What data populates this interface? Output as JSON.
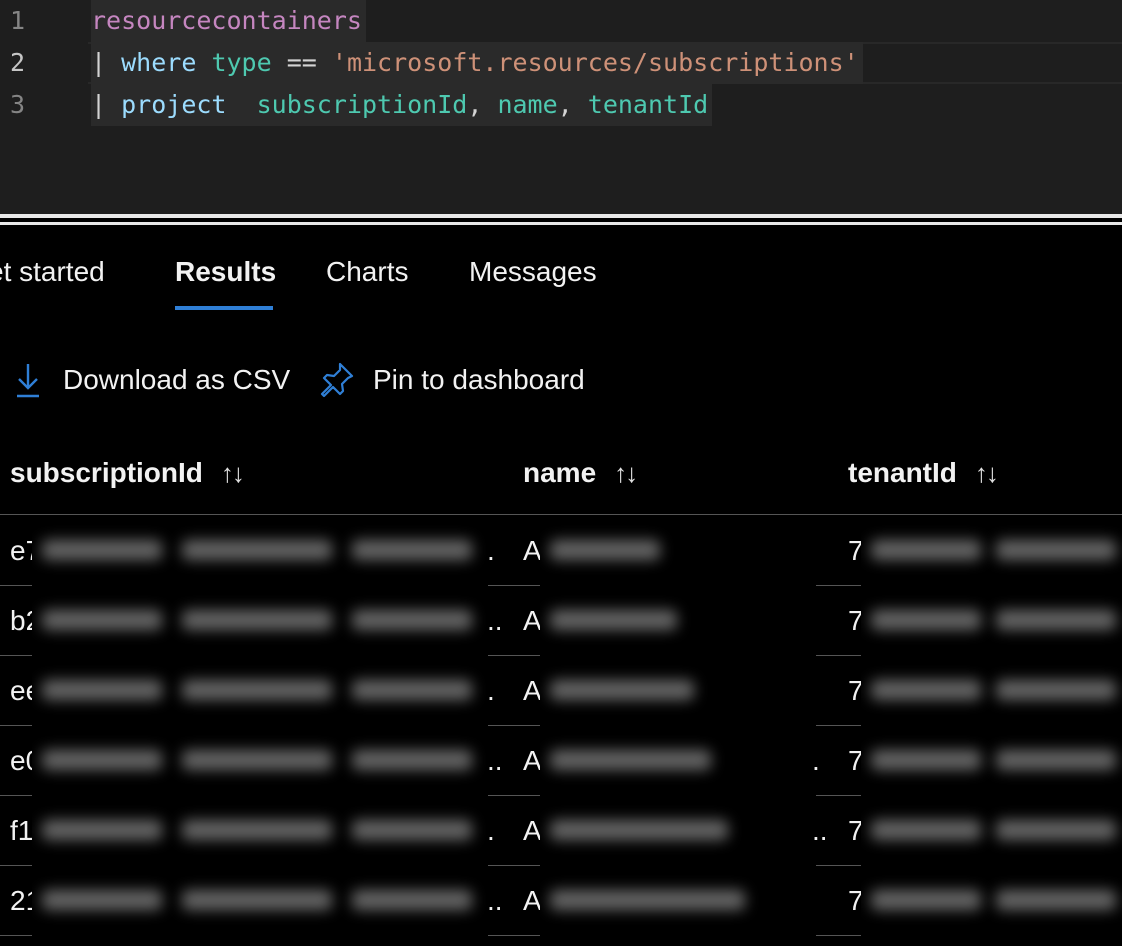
{
  "editor": {
    "lines": [
      {
        "number": "1",
        "tokens": [
          "resourcecontainers"
        ]
      },
      {
        "number": "2",
        "tokens": [
          "|",
          "where",
          "type",
          "==",
          "'microsoft.resources/subscriptions'"
        ]
      },
      {
        "number": "3",
        "tokens": [
          "|",
          "project",
          "subscriptionId",
          ",",
          "name",
          ",",
          "tenantId"
        ]
      }
    ]
  },
  "tabs": [
    "et started",
    "Results",
    "Charts",
    "Messages"
  ],
  "active_tab": "Results",
  "toolbar": {
    "download_label": "Download as CSV",
    "pin_label": "Pin to dashboard",
    "download_icon": "download-arrow-icon",
    "pin_icon": "pin-icon",
    "accent_color": "#2f7fd6"
  },
  "table": {
    "columns": [
      "subscriptionId",
      "name",
      "tenantId"
    ],
    "sort_glyph": "↑↓",
    "rows": [
      {
        "subscriptionId": "e7",
        "name": "A",
        "tenantId": "7"
      },
      {
        "subscriptionId": "b2",
        "name": "A",
        "tenantId": "7"
      },
      {
        "subscriptionId": "ee",
        "name": "A",
        "tenantId": "7"
      },
      {
        "subscriptionId": "e0",
        "name": "A",
        "tenantId": "7"
      },
      {
        "subscriptionId": "f1",
        "name": "A",
        "tenantId": "7"
      },
      {
        "subscriptionId": "21",
        "name": "A",
        "tenantId": "7"
      }
    ],
    "truncation_marks": [
      {
        "subscriptionId": ".",
        "name": ""
      },
      {
        "subscriptionId": "..",
        "name": ""
      },
      {
        "subscriptionId": ".",
        "name": ""
      },
      {
        "subscriptionId": "..",
        "name": "."
      },
      {
        "subscriptionId": ".",
        "name": ".."
      },
      {
        "subscriptionId": "..",
        "name": ""
      }
    ]
  }
}
